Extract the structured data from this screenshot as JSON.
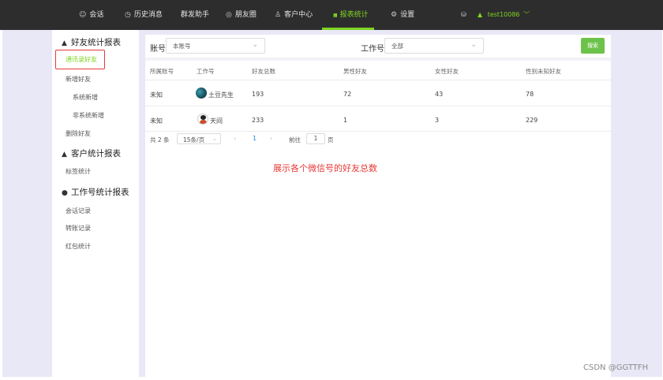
{
  "nav": {
    "items": [
      {
        "icon": "chat-bubble-icon",
        "glyph": "☺",
        "label": "会话"
      },
      {
        "icon": "clock-icon",
        "glyph": "◷",
        "label": "历史消息"
      },
      {
        "icon": "",
        "glyph": "",
        "label": "群发助手"
      },
      {
        "icon": "moments-icon",
        "glyph": "◎",
        "label": "朋友圈"
      },
      {
        "icon": "person-icon",
        "glyph": "♙",
        "label": "客户中心"
      },
      {
        "icon": "bar-chart-icon",
        "glyph": "▮▮",
        "label": "报表统计"
      },
      {
        "icon": "gear-icon",
        "glyph": "⚙",
        "label": "设置"
      }
    ],
    "user": {
      "name": "test10086",
      "chevron": "﹀"
    }
  },
  "sidebar": {
    "groups": [
      {
        "label": "好友统计报表",
        "glyph": "▲"
      },
      {
        "label": "客户统计报表",
        "glyph": "▲"
      },
      {
        "label": "工作号统计报表",
        "glyph": "●"
      }
    ],
    "items": [
      "通讯录好友",
      "新增好友",
      "系统新增",
      "非系统新增",
      "删除好友",
      "标签统计",
      "会话记录",
      "转账记录",
      "红包统计"
    ]
  },
  "filters": {
    "account_label": "账号",
    "account_value": "本账号",
    "worknum_label": "工作号",
    "worknum_value": "全部",
    "search_label": "搜索"
  },
  "table": {
    "headers": [
      "所属账号",
      "工作号",
      "好友总数",
      "男性好友",
      "女性好友",
      "性别未知好友"
    ],
    "rows": [
      {
        "account": "未知",
        "worknum": "土豆先生",
        "total": "193",
        "male": "72",
        "female": "43",
        "unknown": "78"
      },
      {
        "account": "未知",
        "worknum": "天间",
        "total": "233",
        "male": "1",
        "female": "3",
        "unknown": "229"
      }
    ]
  },
  "pager": {
    "total": "共 2 条",
    "page_size": "15条/页",
    "prev": "‹",
    "current": "1",
    "next": "›",
    "goto": "前往",
    "goto_value": "1",
    "page_unit": "页"
  },
  "annotation": "展示各个微信号的好友总数",
  "watermark": "CSDN @GGTTFH",
  "colors": {
    "accent": "#7ed321",
    "annotation": "#e53935",
    "nav_bg": "#2d2d2d"
  }
}
